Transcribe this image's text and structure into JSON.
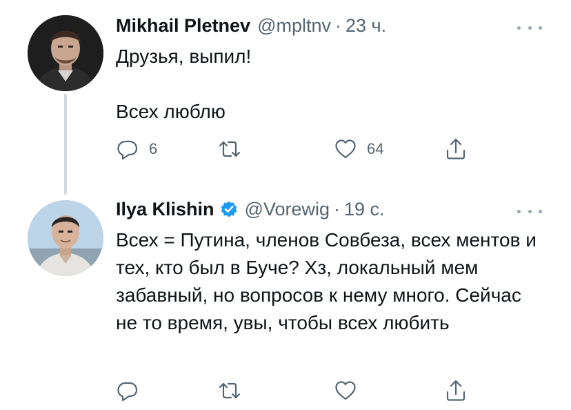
{
  "colors": {
    "text_primary": "#0f1419",
    "text_secondary": "#536471",
    "verified_blue": "#1d9bf0",
    "thread_line": "#cfd9de"
  },
  "tweets": [
    {
      "author_name": "Mikhail Pletnev",
      "handle": "@mpltnv",
      "separator": "·",
      "time": "23 ч.",
      "verified": false,
      "paragraphs": [
        "Друзья, выпил!",
        "Всех люблю"
      ],
      "actions": {
        "reply": {
          "icon": "reply-icon",
          "count": "6"
        },
        "retweet": {
          "icon": "retweet-icon",
          "count": ""
        },
        "like": {
          "icon": "heart-icon",
          "count": "64"
        },
        "share": {
          "icon": "share-icon",
          "count": ""
        }
      }
    },
    {
      "author_name": "Ilya Klishin",
      "handle": "@Vorewig",
      "separator": "·",
      "time": "19 с.",
      "verified": true,
      "paragraphs": [
        "Всех = Путина, членов Совбеза, всех ментов и тех, кто был в Буче? Хз, локальный мем забавный, но вопросов к нему много. Сейчас не то время, увы, чтобы всех любить"
      ],
      "actions": {
        "reply": {
          "icon": "reply-icon",
          "count": ""
        },
        "retweet": {
          "icon": "retweet-icon",
          "count": ""
        },
        "like": {
          "icon": "heart-icon",
          "count": ""
        },
        "share": {
          "icon": "share-icon",
          "count": ""
        }
      }
    }
  ]
}
